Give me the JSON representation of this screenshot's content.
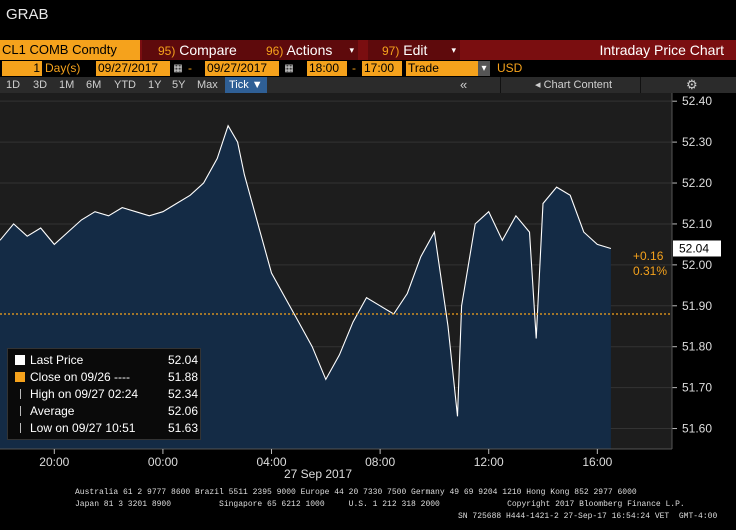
{
  "grab_label": "GRAB",
  "command_bar": {
    "ticker": "CL1 COMB Comdty",
    "compare_num": "95)",
    "compare": "Compare",
    "actions_num": "96)",
    "actions": "Actions",
    "edit_num": "97)",
    "edit": "Edit",
    "title": "Intraday Price Chart"
  },
  "params": {
    "days_value": "1",
    "days_label": "Day(s)",
    "start_date": "09/27/2017",
    "dash": "-",
    "end_date": "09/27/2017",
    "start_time": "18:00",
    "time_dash": "-",
    "end_time": "17:00",
    "event": "Trade",
    "currency": "USD"
  },
  "toolbar": {
    "periods": [
      "1D",
      "3D",
      "1M",
      "6M",
      "YTD",
      "1Y",
      "5Y",
      "Max"
    ],
    "selected": "Tick ▼",
    "collapse": "«",
    "chart_content": "Chart Content",
    "settings_icon": "gear-icon"
  },
  "legend": [
    {
      "label": "Last Price",
      "value": "52.04",
      "color": "#ffffff"
    },
    {
      "label": "Close on 09/26  ----",
      "value": "51.88",
      "color": "#f5a21c"
    },
    {
      "label": "High on 09/27 02:24",
      "value": "52.34",
      "color": "#bbbbbb"
    },
    {
      "label": "Average",
      "value": "52.06",
      "color": "#bbbbbb"
    },
    {
      "label": "Low on 09/27 10:51",
      "value": "51.63",
      "color": "#bbbbbb"
    }
  ],
  "last_change": {
    "abs": "+0.16",
    "pct": "0.31%"
  },
  "colors": {
    "accent": "#f5a21c",
    "header_red": "#7a0e10",
    "area_fill": "#142b45",
    "line": "#ffffff"
  },
  "chart_data": {
    "type": "area",
    "x_tick_labels": [
      "20:00",
      "00:00",
      "04:00",
      "08:00",
      "12:00",
      "16:00"
    ],
    "x_date_label": "27 Sep 2017",
    "y_tick_labels": [
      "52.40",
      "52.30",
      "52.20",
      "52.10",
      "52.00",
      "51.90",
      "51.80",
      "51.70",
      "51.60"
    ],
    "ylim": [
      51.55,
      52.42
    ],
    "last_price_label": "52.04",
    "reference_line": 51.88,
    "high": 52.34,
    "low": 51.63,
    "series": [
      {
        "x": [
          "18:00",
          "18:30",
          "19:00",
          "19:30",
          "20:00",
          "20:30",
          "21:00",
          "21:30",
          "22:00",
          "22:30",
          "23:00",
          "23:30",
          "00:00",
          "00:30",
          "01:00",
          "01:30",
          "02:00",
          "02:24",
          "02:45",
          "03:00",
          "03:30",
          "04:00",
          "04:30",
          "05:00",
          "05:30",
          "06:00",
          "06:30",
          "07:00",
          "07:30",
          "08:00",
          "08:30",
          "09:00",
          "09:30",
          "10:00",
          "10:30",
          "10:51",
          "11:00",
          "11:30",
          "12:00",
          "12:30",
          "13:00",
          "13:30",
          "13:45",
          "14:00",
          "14:30",
          "15:00",
          "15:30",
          "16:00",
          "16:30"
        ],
        "values": [
          52.06,
          52.1,
          52.07,
          52.09,
          52.05,
          52.08,
          52.11,
          52.13,
          52.12,
          52.14,
          52.13,
          52.12,
          52.13,
          52.15,
          52.17,
          52.2,
          52.26,
          52.34,
          52.3,
          52.22,
          52.1,
          51.98,
          51.92,
          51.86,
          51.8,
          51.72,
          51.78,
          51.86,
          51.92,
          51.9,
          51.88,
          51.93,
          52.02,
          52.08,
          51.85,
          51.63,
          51.9,
          52.1,
          52.13,
          52.06,
          52.12,
          52.08,
          51.82,
          52.15,
          52.19,
          52.17,
          52.08,
          52.05,
          52.04
        ]
      }
    ]
  },
  "footer": {
    "line1": "Australia 61 2 9777 8600 Brazil 5511 2395 9000 Europe 44 20 7330 7500 Germany 49 69 9204 1210 Hong Kong 852 2977 6000",
    "line2": "Japan 81 3 3201 8900          Singapore 65 6212 1000     U.S. 1 212 318 2000              Copyright 2017 Bloomberg Finance L.P.",
    "line3": "SN 725688 H444-1421-2 27-Sep-17 16:54:24 VET  GMT-4:00"
  }
}
